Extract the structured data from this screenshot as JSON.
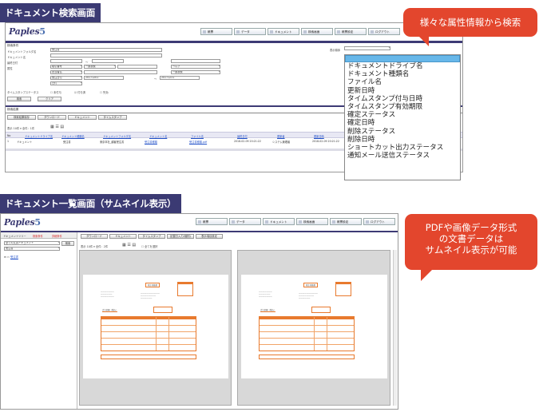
{
  "labels": {
    "search_screen": "ドキュメント検索画面",
    "list_screen": "ドキュメント一覧画面（サムネイル表示）"
  },
  "callouts": {
    "attr_search": "様々な属性情報から検索",
    "thumb_lines": [
      "PDFや画像データ形式",
      "の文書データは",
      "サムネイル表示が可能"
    ]
  },
  "app": {
    "logo": "Paples",
    "logo_num": "5"
  },
  "toolbar": {
    "items": [
      "帳票",
      "データ",
      "ドキュメント",
      "検索画面",
      "帳票設定",
      "ログアウト"
    ]
  },
  "search": {
    "section_title": "検索条件",
    "fields": [
      {
        "label": "ドキュメントフォルダ名",
        "value": "受注書"
      },
      {
        "label": "ドキュメント名",
        "value": ""
      },
      {
        "label": "最終日付",
        "value": ""
      },
      {
        "label": "属性",
        "value": "取引番号"
      },
      {
        "label": "",
        "value": "担当者名"
      },
      {
        "label": "",
        "value": "受注日付"
      }
    ],
    "op_eq": "一致検索",
    "val_day": "日付",
    "from": "20171201",
    "to": "20171231",
    "tilde": "〜",
    "range_op": "〜以下",
    "all": "一致検索",
    "status_label": "タイムスタンプステータス",
    "checks": [
      "未付与",
      "付与済",
      "失効"
    ],
    "search_btn": "検索",
    "clear_btn": "クリア",
    "sort_label": "表示順序"
  },
  "attr_options": [
    "ドキュメントドライブ名",
    "ドキュメント種類名",
    "ファイル名",
    "更新日時",
    "タイムスタンプ付与日時",
    "タイムスタンプ有効期限",
    "確定ステータス",
    "確定日時",
    "削除ステータス",
    "削除日時",
    "ショートカット出力ステータス",
    "通知メール送信ステータス"
  ],
  "results": {
    "section_title": "検索結果",
    "actions": [
      "検索結果保存",
      "ダウンロード",
      "ドキュメント",
      "タイムスタンプ"
    ],
    "paging": "表示 10件 ▾  全件：1件",
    "columns": [
      "No",
      "ドキュメントドライブ名",
      "ドキュメント種類名",
      "ドキュメントフォルダ名",
      "ドキュメント名",
      "ファイル名",
      "最終日付",
      "更新者",
      "更新日時"
    ],
    "rows": [
      [
        "1",
        "ドキュメント",
        "受注書",
        "東京本社_顧客受注書",
        "受注書種類",
        "受注書種類.pdf",
        "2018-02-09 20:21:22",
        "システム管理者",
        "2018-02-09 20:21:22"
      ]
    ]
  },
  "list": {
    "tabs": [
      "ドキュメントツリー",
      "検索条件",
      "詳細条件"
    ],
    "tree_select": "全ての文書ドキュメント",
    "tree_select2": "受注書",
    "tree_btn": "検索",
    "tree_item": "受注書",
    "actions": [
      "ダウンロード",
      "ドキュメント",
      "タイムスタンプ",
      "記載日入力(個別)",
      "表示項目設定"
    ],
    "paging": "表示 10件 ▾  全件：2件",
    "check_all": "全てを選択",
    "doc_title": "発注見積書",
    "doc_total_label": "合計金額（税込）"
  }
}
